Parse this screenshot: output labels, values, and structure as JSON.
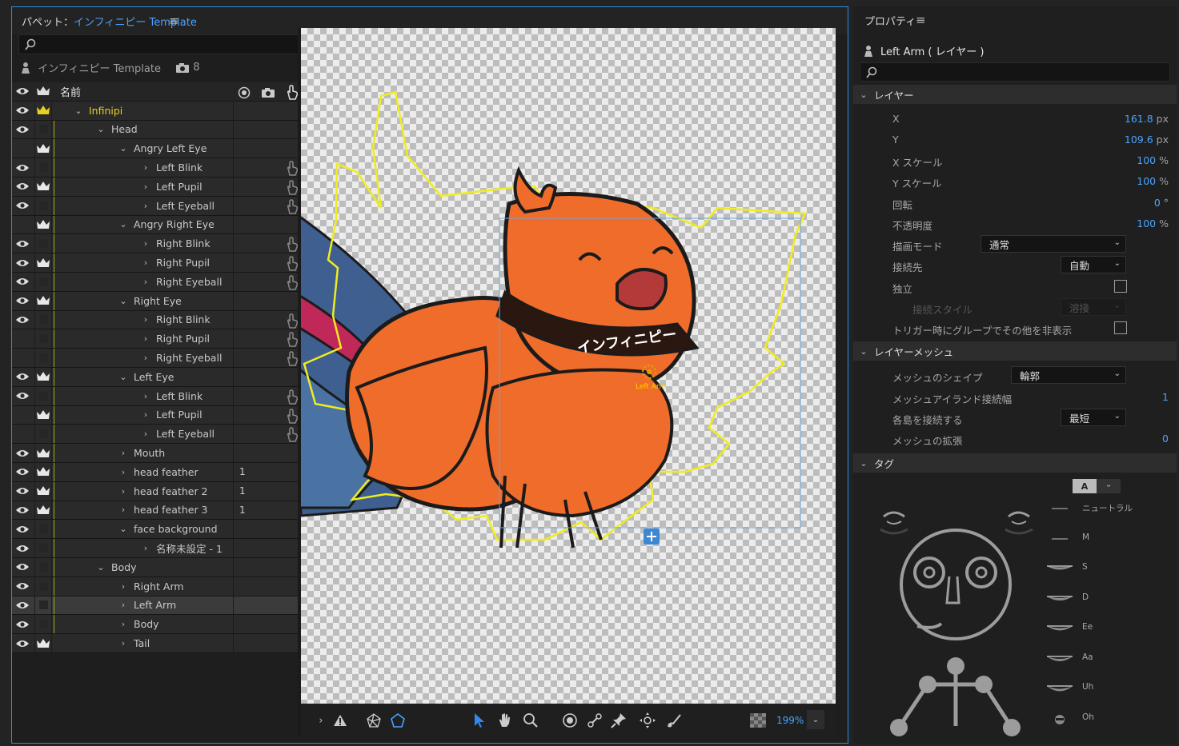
{
  "puppet_panel": {
    "title_prefix": "パペット：",
    "title_name": "インフィニピー Template",
    "menu": "≡",
    "root_name": "インフィニピー Template",
    "root_count": "8"
  },
  "layers": {
    "header": {
      "name": "名前"
    },
    "rows": [
      {
        "name": "Infinipi",
        "indent": 1,
        "chevron": "⌄",
        "crown": "yellow",
        "eye": true,
        "yline": false
      },
      {
        "name": "Head",
        "indent": 2,
        "chevron": "⌄",
        "crown": "none",
        "eye": true,
        "yline": true
      },
      {
        "name": "Angry Left Eye",
        "indent": 3,
        "chevron": "⌄",
        "crown": "white",
        "eye": false,
        "yline": true
      },
      {
        "name": "Left Blink",
        "indent": 4,
        "chevron": "›",
        "crown": "none",
        "eye": true,
        "hand": true,
        "yline": true
      },
      {
        "name": "Left Pupil",
        "indent": 4,
        "chevron": "›",
        "crown": "white",
        "eye": true,
        "hand": true,
        "yline": true
      },
      {
        "name": "Left Eyeball",
        "indent": 4,
        "chevron": "›",
        "crown": "none",
        "eye": true,
        "hand": true,
        "yline": true
      },
      {
        "name": "Angry Right Eye",
        "indent": 3,
        "chevron": "⌄",
        "crown": "white",
        "eye": false,
        "yline": true
      },
      {
        "name": "Right Blink",
        "indent": 4,
        "chevron": "›",
        "crown": "none",
        "eye": true,
        "hand": true,
        "yline": true
      },
      {
        "name": "Right Pupil",
        "indent": 4,
        "chevron": "›",
        "crown": "white",
        "eye": true,
        "hand": true,
        "yline": true
      },
      {
        "name": "Right Eyeball",
        "indent": 4,
        "chevron": "›",
        "crown": "none",
        "eye": true,
        "hand": true,
        "yline": true
      },
      {
        "name": "Right Eye",
        "indent": 3,
        "chevron": "⌄",
        "crown": "white",
        "eye": true,
        "yline": true
      },
      {
        "name": "Right Blink",
        "indent": 4,
        "chevron": "›",
        "crown": "none",
        "eye": true,
        "hand": true,
        "yline": true
      },
      {
        "name": "Right Pupil",
        "indent": 4,
        "chevron": "›",
        "crown": "none",
        "eye": false,
        "hand": true,
        "yline": true
      },
      {
        "name": "Right Eyeball",
        "indent": 4,
        "chevron": "›",
        "crown": "none",
        "eye": false,
        "hand": true,
        "yline": true
      },
      {
        "name": "Left Eye",
        "indent": 3,
        "chevron": "⌄",
        "crown": "white",
        "eye": true,
        "yline": true
      },
      {
        "name": "Left Blink",
        "indent": 4,
        "chevron": "›",
        "crown": "none",
        "eye": true,
        "hand": true,
        "yline": true
      },
      {
        "name": "Left Pupil",
        "indent": 4,
        "chevron": "›",
        "crown": "white",
        "eye": false,
        "hand": true,
        "yline": true
      },
      {
        "name": "Left Eyeball",
        "indent": 4,
        "chevron": "›",
        "crown": "none",
        "eye": false,
        "hand": true,
        "yline": true
      },
      {
        "name": "Mouth",
        "indent": 3,
        "chevron": "›",
        "crown": "white",
        "eye": true,
        "yline": true
      },
      {
        "name": "head feather",
        "indent": 3,
        "chevron": "›",
        "crown": "white",
        "eye": true,
        "num": "1",
        "yline": true
      },
      {
        "name": "head feather 2",
        "indent": 3,
        "chevron": "›",
        "crown": "white",
        "eye": true,
        "num": "1",
        "yline": true
      },
      {
        "name": "head feather 3",
        "indent": 3,
        "chevron": "›",
        "crown": "white",
        "eye": true,
        "num": "1",
        "yline": true
      },
      {
        "name": "face background",
        "indent": 3,
        "chevron": "⌄",
        "crown": "none",
        "eye": true,
        "yline": true
      },
      {
        "name": "名称未設定 - 1",
        "indent": 4,
        "chevron": "›",
        "crown": "none",
        "eye": true,
        "yline": true
      },
      {
        "name": "Body",
        "indent": 2,
        "chevron": "⌄",
        "crown": "none",
        "eye": true,
        "yline": true
      },
      {
        "name": "Right Arm",
        "indent": 3,
        "chevron": "›",
        "crown": "none",
        "eye": true,
        "yline": true
      },
      {
        "name": "Left Arm",
        "indent": 3,
        "chevron": "›",
        "crown": "none",
        "eye": true,
        "selected": true,
        "yline": true
      },
      {
        "name": "Body",
        "indent": 3,
        "chevron": "›",
        "crown": "none",
        "eye": true,
        "yline": true
      },
      {
        "name": "Tail",
        "indent": 3,
        "chevron": "›",
        "crown": "white",
        "eye": true,
        "yline": false
      }
    ]
  },
  "canvas": {
    "banner_text": "インフィニピー",
    "handle_label": "Left Arm"
  },
  "toolbar": {
    "zoom": "199%"
  },
  "properties": {
    "title": "プロパティ",
    "menu": "≡",
    "layer_name": "Left Arm ( レイヤー )",
    "sections": {
      "layer": "レイヤー",
      "mesh": "レイヤーメッシュ",
      "tags": "タグ"
    },
    "layer": {
      "x_label": "X",
      "x_val": "161.8",
      "x_unit": " px",
      "y_label": "Y",
      "y_val": "109.6",
      "y_unit": " px",
      "xs_label": "X スケール",
      "xs_val": "100",
      "xs_unit": " %",
      "ys_label": "Y スケール",
      "ys_val": "100",
      "ys_unit": " %",
      "rot_label": "回転",
      "rot_val": "0",
      "rot_unit": " °",
      "op_label": "不透明度",
      "op_val": "100",
      "op_unit": " %",
      "blend_label": "描画モード",
      "blend_val": "通常",
      "attach_label": "接続先",
      "attach_val": "自動",
      "indep_label": "独立",
      "style_label": "接続スタイル",
      "style_val": "溶接",
      "trigger_label": "トリガー時にグループでその他を非表示"
    },
    "mesh": {
      "shape_label": "メッシュのシェイプ",
      "shape_val": "輪郭",
      "island_label": "メッシュアイランド接続幅",
      "island_val": "1",
      "connect_label": "各島を接続する",
      "connect_val": "最短",
      "expand_label": "メッシュの拡張",
      "expand_val": "0"
    },
    "tags": {
      "toggle_a": "A",
      "visemes": [
        "ニュートラル",
        "M",
        "S",
        "D",
        "Ee",
        "Aa",
        "Uh",
        "Oh"
      ]
    }
  },
  "colors": {
    "accent": "#2d8ceb",
    "blue_text": "#4aa3ff",
    "crown_yellow": "#e6d21e",
    "mesh_yellow": "#f0ec20",
    "bird": "#f06c2a"
  }
}
